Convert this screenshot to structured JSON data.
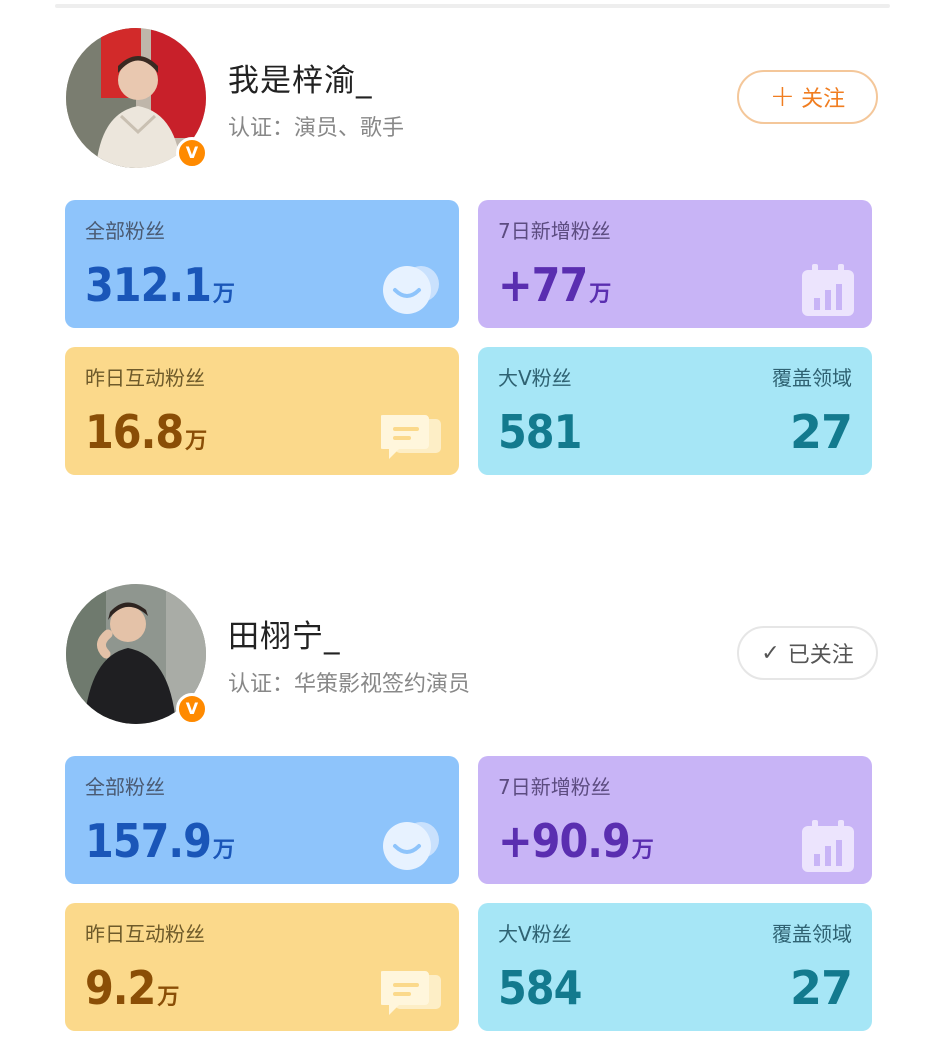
{
  "profiles": [
    {
      "name": "我是梓渝_",
      "cert": "认证：演员、歌手",
      "badge": "V",
      "button": {
        "label": "关注",
        "icon": "plus-icon",
        "state": "unfollowed"
      },
      "stats": {
        "total_fans": {
          "label": "全部粉丝",
          "value": "312.1",
          "unit": "万"
        },
        "new_fans_7d": {
          "label": "7日新增粉丝",
          "value": "+77",
          "unit": "万"
        },
        "interact_yesterday": {
          "label": "昨日互动粉丝",
          "value": "16.8",
          "unit": "万"
        },
        "bigv_fans": {
          "label": "大V粉丝",
          "value": "581",
          "right_label": "覆盖领域",
          "right_value": "27"
        }
      }
    },
    {
      "name": "田栩宁_",
      "cert": "认证：华策影视签约演员",
      "badge": "V",
      "button": {
        "label": "已关注",
        "icon": "check-icon",
        "state": "followed"
      },
      "stats": {
        "total_fans": {
          "label": "全部粉丝",
          "value": "157.9",
          "unit": "万"
        },
        "new_fans_7d": {
          "label": "7日新增粉丝",
          "value": "+90.9",
          "unit": "万"
        },
        "interact_yesterday": {
          "label": "昨日互动粉丝",
          "value": "9.2",
          "unit": "万"
        },
        "bigv_fans": {
          "label": "大V粉丝",
          "value": "584",
          "right_label": "覆盖领域",
          "right_value": "27"
        }
      }
    }
  ],
  "colors": {
    "blue_card": "#8ec4fb",
    "purple_card": "#c8b4f6",
    "yellow_card": "#fbd98b",
    "cyan_card": "#a6e6f6",
    "follow_accent": "#f07d20",
    "verified_badge": "#ff8a00"
  }
}
